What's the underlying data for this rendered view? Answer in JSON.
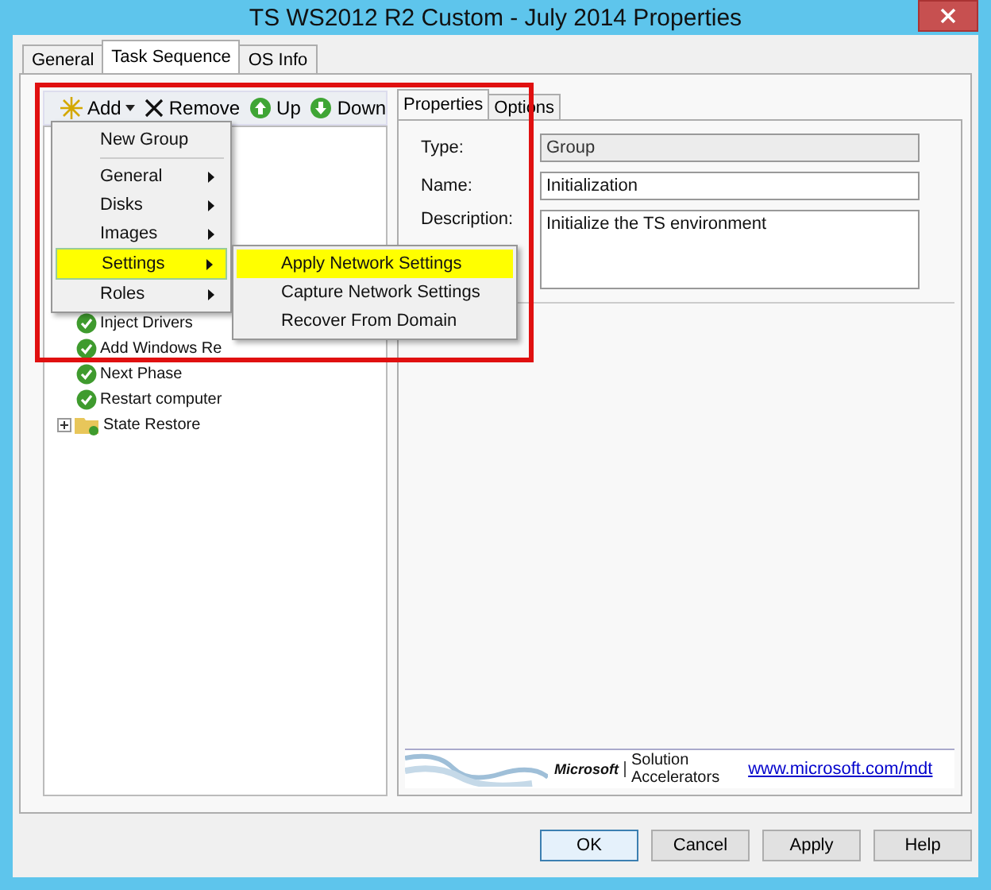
{
  "window": {
    "title": "TS WS2012 R2 Custom - July 2014 Properties"
  },
  "tabs": [
    {
      "label": "General",
      "selected": false
    },
    {
      "label": "Task Sequence",
      "selected": true
    },
    {
      "label": "OS Info",
      "selected": false
    }
  ],
  "toolbar": [
    {
      "label": "Add",
      "kind": "add",
      "dropdown": true
    },
    {
      "label": "Remove",
      "kind": "remove",
      "dropdown": false
    },
    {
      "label": "Up",
      "kind": "up",
      "dropdown": false
    },
    {
      "label": "Down",
      "kind": "down",
      "dropdown": false
    }
  ],
  "add_menu": [
    {
      "kind": "item",
      "label": "New Group",
      "submenu": false,
      "selected": false
    },
    {
      "kind": "separator"
    },
    {
      "kind": "item",
      "label": "General",
      "submenu": true,
      "selected": false
    },
    {
      "kind": "item",
      "label": "Disks",
      "submenu": true,
      "selected": false
    },
    {
      "kind": "item",
      "label": "Images",
      "submenu": true,
      "selected": false
    },
    {
      "kind": "item",
      "label": "Settings",
      "submenu": true,
      "selected": true
    },
    {
      "kind": "item",
      "label": "Roles",
      "submenu": true,
      "selected": false
    }
  ],
  "settings_submenu": [
    {
      "label": "Apply Network Settings",
      "selected": true
    },
    {
      "label": "Capture Network Settings",
      "selected": false
    },
    {
      "label": "Recover From Domain",
      "selected": false
    }
  ],
  "tree": [
    {
      "kind": "group",
      "children": [
        {
          "kind": "step",
          "label": "Inject Drivers"
        },
        {
          "kind": "step",
          "label": "Add Windows Re"
        },
        {
          "kind": "step",
          "label": "Next Phase"
        },
        {
          "kind": "step",
          "label": "Restart computer"
        }
      ]
    },
    {
      "kind": "folder",
      "label": "State Restore",
      "expanded": false
    }
  ],
  "detail_tabs": [
    {
      "label": "Properties",
      "selected": true
    },
    {
      "label": "Options",
      "selected": false
    }
  ],
  "fields": [
    {
      "label": "Type:",
      "value": "Group",
      "disabled": true,
      "multiline": false
    },
    {
      "label": "Name:",
      "value": "Initialization",
      "disabled": false,
      "multiline": false
    },
    {
      "label": "Description:",
      "value": "Initialize the TS environment",
      "disabled": false,
      "multiline": true
    }
  ],
  "banner": {
    "brand": "Microsoft",
    "product": "Solution Accelerators",
    "link": "www.microsoft.com/mdt"
  },
  "buttons": [
    {
      "label": "OK",
      "default": true
    },
    {
      "label": "Cancel",
      "default": false
    },
    {
      "label": "Apply",
      "default": false
    },
    {
      "label": "Help",
      "default": false
    }
  ]
}
